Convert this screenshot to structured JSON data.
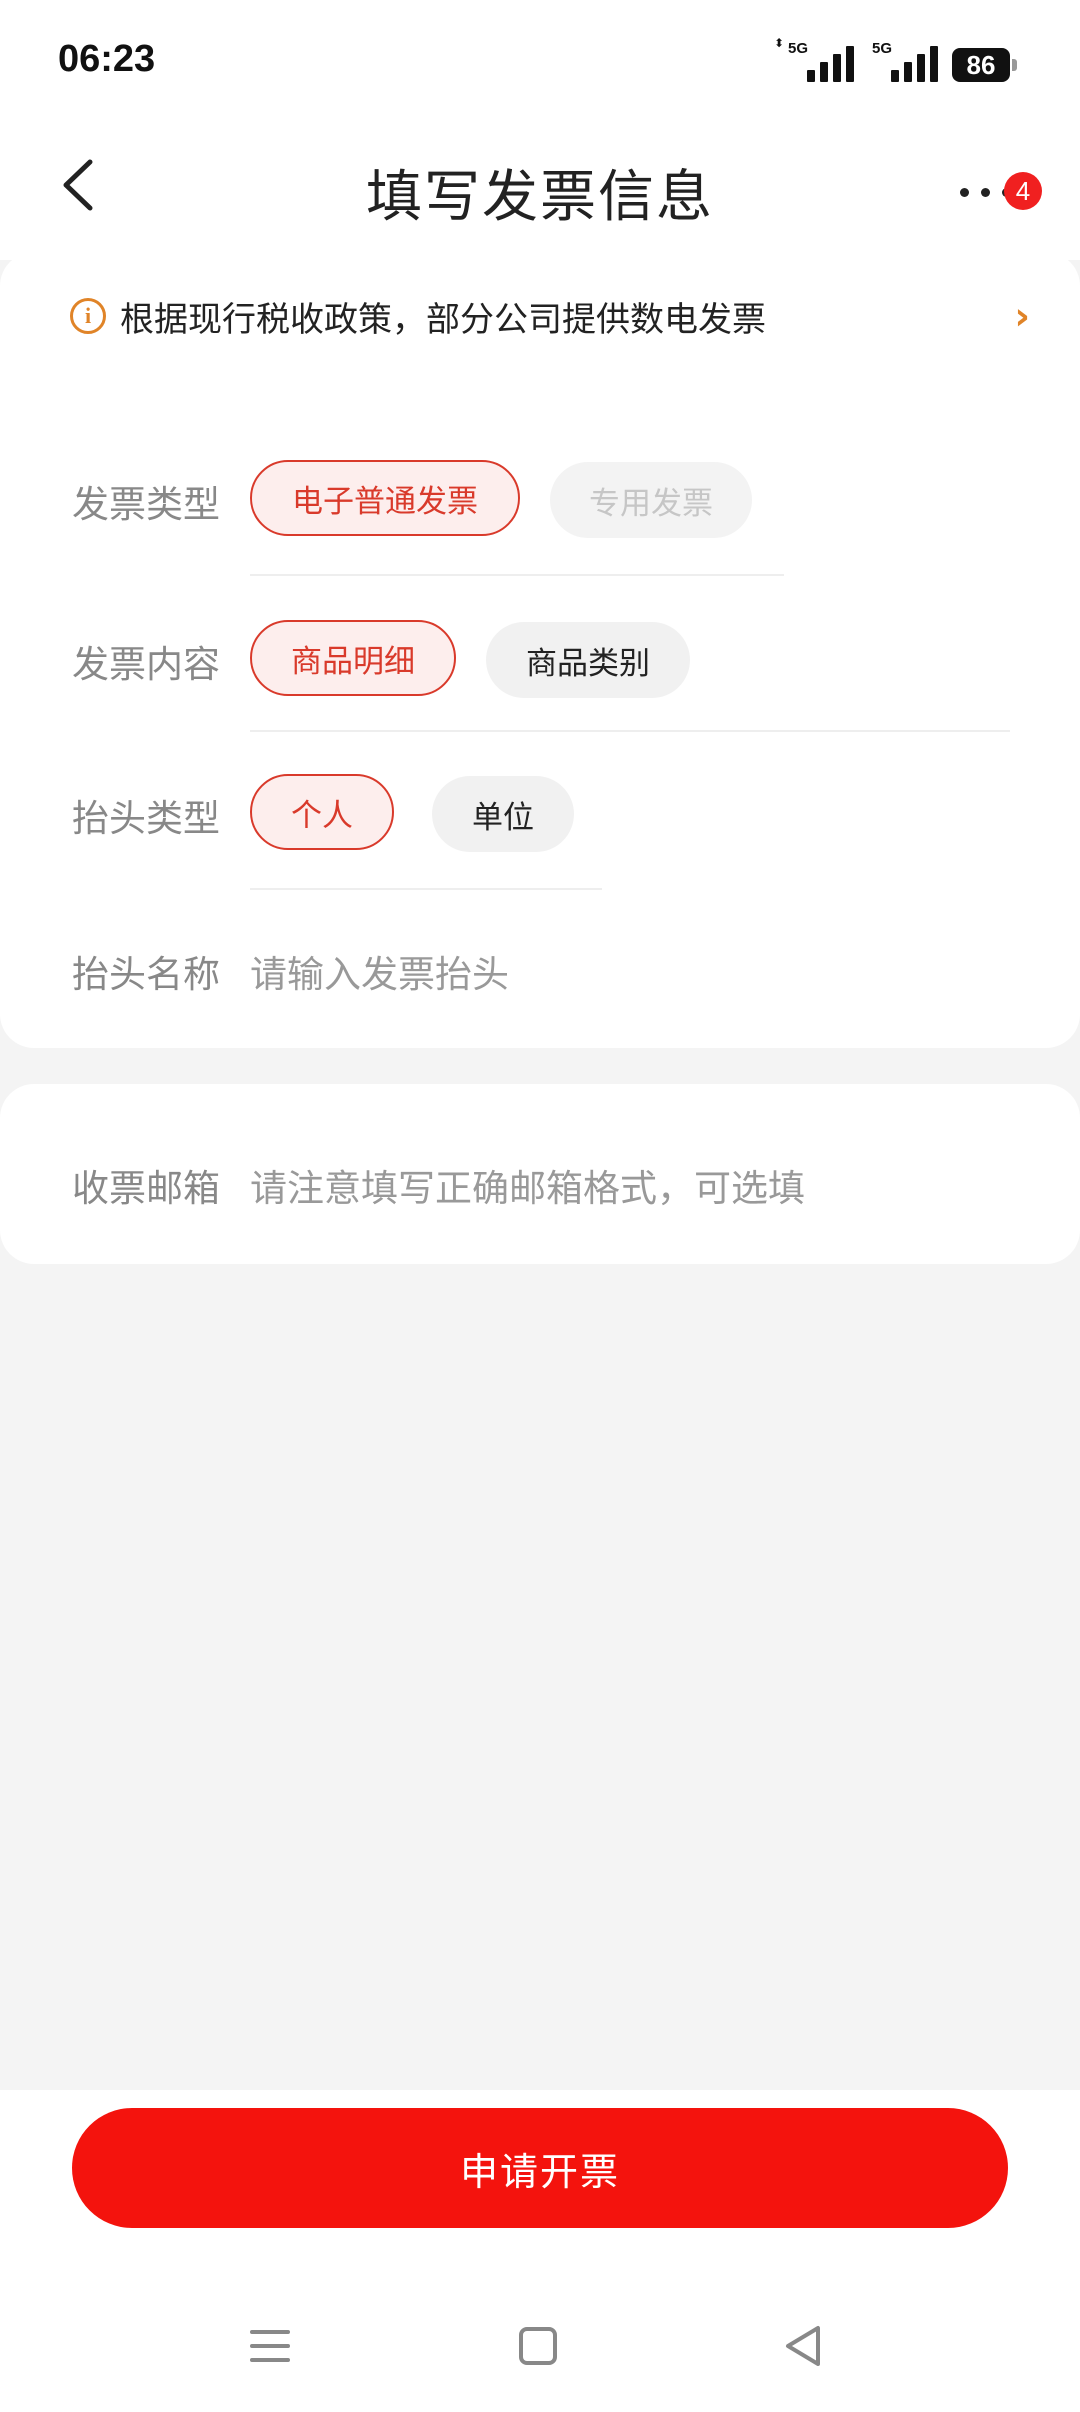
{
  "status_bar": {
    "time": "06:23",
    "network_1": "5G",
    "network_2": "5G",
    "battery": "86"
  },
  "header": {
    "title": "填写发票信息",
    "badge_count": "4"
  },
  "notice": {
    "text": "根据现行税收政策，部分公司提供数电发票",
    "arrow": "›"
  },
  "invoice_type": {
    "label": "发票类型",
    "options": [
      "电子普通发票",
      "专用发票"
    ],
    "selected": "电子普通发票"
  },
  "invoice_content": {
    "label": "发票内容",
    "options": [
      "商品明细",
      "商品类别"
    ],
    "selected": "商品明细"
  },
  "title_type": {
    "label": "抬头类型",
    "options": [
      "个人",
      "单位"
    ],
    "selected": "个人"
  },
  "title_name": {
    "label": "抬头名称",
    "placeholder": "请输入发票抬头"
  },
  "email": {
    "label": "收票邮箱",
    "placeholder": "请注意填写正确邮箱格式，可选填"
  },
  "apply_button": {
    "label": "申请开票"
  },
  "icons": {
    "back": "chevron-left-icon",
    "more": "more-dots-icon",
    "info": "info-icon",
    "nav_menu": "menu-icon",
    "nav_home": "square-home-icon",
    "nav_back": "triangle-back-icon"
  },
  "colors": {
    "accent": "#f4130d",
    "selected_chip_text": "#d93a2b",
    "notice_orange": "#e08428"
  }
}
